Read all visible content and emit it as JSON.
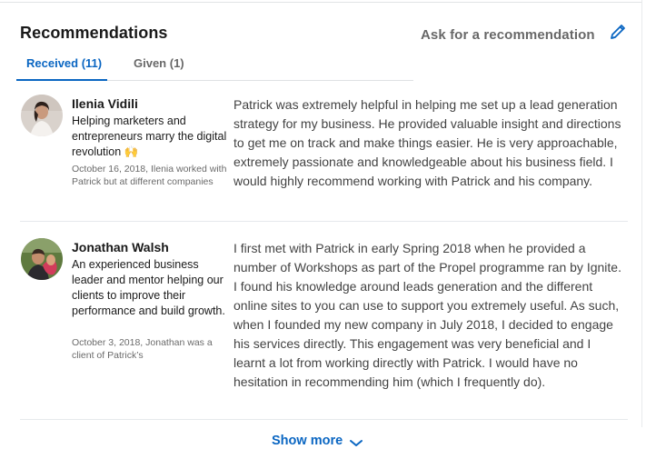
{
  "section": {
    "title": "Recommendations",
    "ask_link": "Ask for a recommendation"
  },
  "tabs": [
    {
      "label": "Received (11)",
      "active": true
    },
    {
      "label": "Given (1)",
      "active": false
    }
  ],
  "recommendations": [
    {
      "name": "Ilenia Vidili",
      "headline": "Helping marketers and entrepreneurs marry the digital revolution 🙌",
      "meta": "October 16, 2018, Ilenia worked with Patrick but at different companies",
      "text": "Patrick was extremely helpful in helping me set up a lead generation strategy for my business. He provided valuable insight and directions to get me on track and make things easier. He is very approachable, extremely passionate and knowledgeable about his business field. I would highly recommend working with Patrick and his company."
    },
    {
      "name": "Jonathan Walsh",
      "headline": "An experienced business leader and mentor helping our clients to improve their performance and build growth.",
      "meta": "October 3, 2018, Jonathan was a client of Patrick’s",
      "text": "I first met with Patrick in early Spring 2018 when he provided a number of Workshops as part of the Propel programme ran by Ignite. I found his knowledge around leads generation and the different online sites to you can use to support you extremely useful. As such, when I founded my new company in July 2018, I decided to engage his services directly. This engagement was very beneficial and I learnt a lot from working directly with Patrick. I would have no hesitation in recommending him (which I frequently do)."
    }
  ],
  "footer": {
    "show_more": "Show more"
  },
  "colors": {
    "accent": "#0a66c2",
    "divider": "#e6e9ec",
    "muted_text": "#666666"
  },
  "icons": {
    "edit": "pencil-icon",
    "show_more": "chevron-down-icon"
  }
}
